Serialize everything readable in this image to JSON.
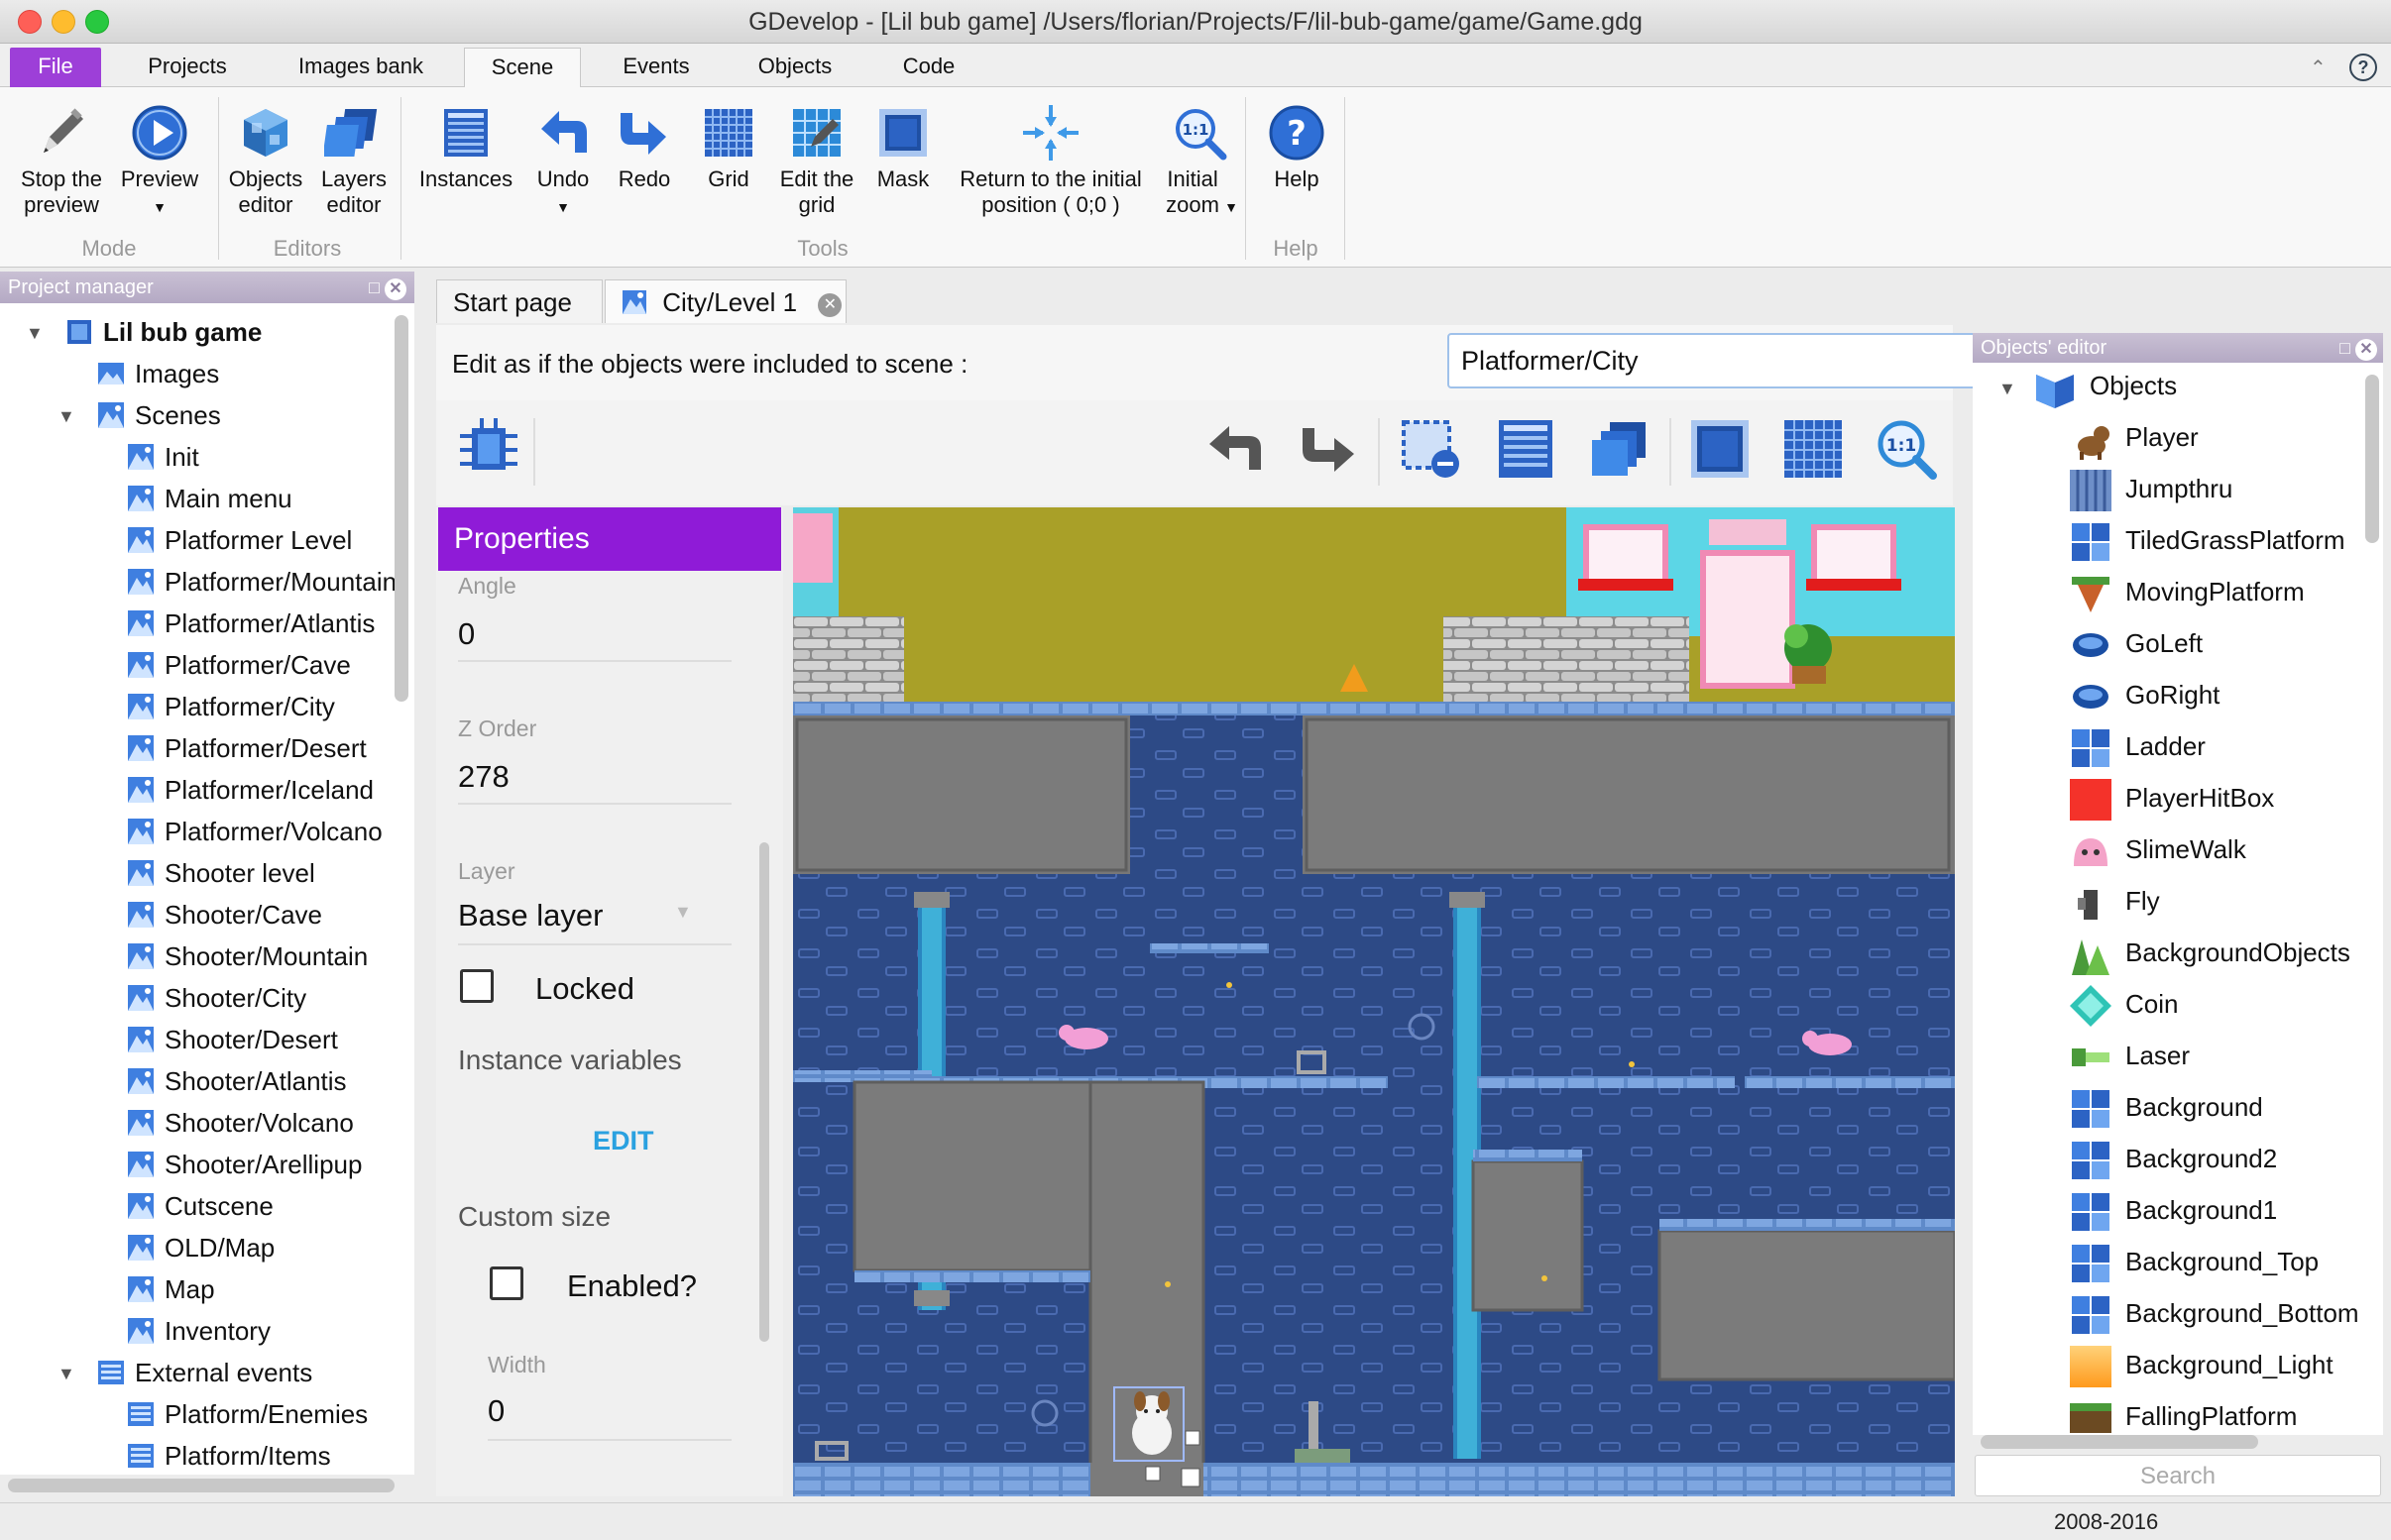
{
  "window": {
    "title": "GDevelop - [Lil bub game] /Users/florian/Projects/F/lil-bub-game/game/Game.gdg"
  },
  "ribbon_tabs": [
    "File",
    "Projects",
    "Images bank",
    "Scene",
    "Events",
    "Objects",
    "Code"
  ],
  "ribbon": {
    "mode": {
      "label": "Mode",
      "stop_preview": "Stop the preview",
      "preview": "Preview"
    },
    "editors": {
      "label": "Editors",
      "objects_editor": "Objects editor",
      "layers_editor": "Layers editor"
    },
    "tools": {
      "label": "Tools",
      "instances": "Instances",
      "undo": "Undo",
      "redo": "Redo",
      "grid": "Grid",
      "edit_grid": "Edit the grid",
      "mask": "Mask",
      "return_initial": "Return to the initial position ( 0;0 )",
      "initial_zoom": "Initial zoom"
    },
    "help": {
      "label": "Help",
      "help": "Help"
    }
  },
  "project_manager": {
    "title": "Project manager",
    "project_name": "Lil bub game",
    "images": "Images",
    "scenes_label": "Scenes",
    "scenes": [
      "Init",
      "Main menu",
      "Platformer Level",
      "Platformer/Mountain",
      "Platformer/Atlantis",
      "Platformer/Cave",
      "Platformer/City",
      "Platformer/Desert",
      "Platformer/Iceland",
      "Platformer/Volcano",
      "Shooter level",
      "Shooter/Cave",
      "Shooter/Mountain",
      "Shooter/City",
      "Shooter/Desert",
      "Shooter/Atlantis",
      "Shooter/Volcano",
      "Shooter/Arellipup",
      "Cutscene",
      "OLD/Map",
      "Map",
      "Inventory"
    ],
    "external_events_label": "External events",
    "external_events": [
      "Platform/Enemies",
      "Platform/Items"
    ]
  },
  "doc_tabs": {
    "start_page": "Start page",
    "city_level": "City/Level 1"
  },
  "edit_as": {
    "label": "Edit as if the objects were included to scene :",
    "value": "Platformer/City"
  },
  "properties": {
    "title": "Properties",
    "angle_label": "Angle",
    "angle_value": "0",
    "z_order_label": "Z Order",
    "z_order_value": "278",
    "layer_label": "Layer",
    "layer_value": "Base layer",
    "locked_label": "Locked",
    "instance_variables_label": "Instance variables",
    "edit_label": "EDIT",
    "custom_size_label": "Custom size",
    "enabled_label": "Enabled?",
    "width_label": "Width",
    "width_value": "0"
  },
  "objects_editor": {
    "title": "Objects' editor",
    "root": "Objects",
    "items": [
      "Player",
      "Jumpthru",
      "TiledGrassPlatform",
      "MovingPlatform",
      "GoLeft",
      "GoRight",
      "Ladder",
      "PlayerHitBox",
      "SlimeWalk",
      "Fly",
      "BackgroundObjects",
      "Coin",
      "Laser",
      "Background",
      "Background2",
      "Background1",
      "Background_Top",
      "Background_Bottom",
      "Background_Light",
      "FallingPlatform"
    ],
    "search_placeholder": "Search"
  },
  "status": {
    "text": "2008-2016"
  },
  "colors": {
    "accent": "#9d3fd8",
    "properties_header": "#8f1bd7",
    "panel_header": "#b4a9c4",
    "link": "#2aa1e0"
  }
}
